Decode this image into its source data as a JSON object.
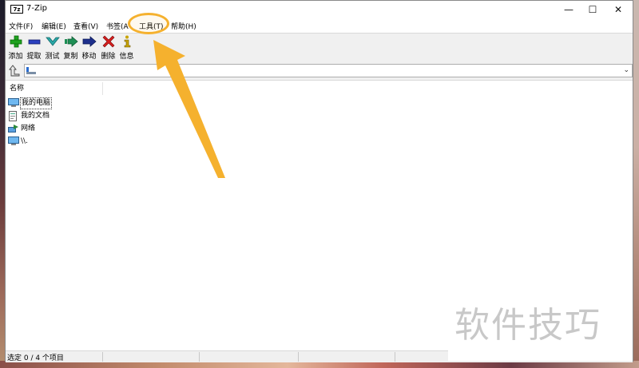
{
  "window": {
    "title": "7-Zip",
    "app_icon_text": "7z",
    "controls": [
      "minimize-icon",
      "maximize-icon",
      "close-icon"
    ]
  },
  "menu": [
    {
      "label": "文件(F)"
    },
    {
      "label": "编辑(E)"
    },
    {
      "label": "查看(V)"
    },
    {
      "label": "书签(A"
    },
    {
      "label": "工具(T)"
    },
    {
      "label": "帮助(H)"
    }
  ],
  "toolbar": {
    "buttons": [
      {
        "label": "添加",
        "icon": "plus-icon",
        "color": "#1fa21f"
      },
      {
        "label": "提取",
        "icon": "minus-icon",
        "color": "#2a3fbf"
      },
      {
        "label": "测试",
        "icon": "check-icon",
        "color": "#2aa8a8"
      },
      {
        "label": "复制",
        "icon": "copy-arrow-icon",
        "color": "#1e8f55"
      },
      {
        "label": "移动",
        "icon": "move-arrow-icon",
        "color": "#1d2f8c"
      },
      {
        "label": "删除",
        "icon": "delete-x-icon",
        "color": "#d41e1e"
      },
      {
        "label": "信息",
        "icon": "info-icon",
        "color": "#c9a400"
      }
    ]
  },
  "address": {
    "value": "",
    "icon": "computer-drive-icon"
  },
  "list": {
    "column_name": "名称",
    "items": [
      {
        "label": "我的电脑",
        "icon": "computer-icon",
        "focused": true
      },
      {
        "label": "我的文档",
        "icon": "documents-icon",
        "focused": false
      },
      {
        "label": "网络",
        "icon": "network-icon",
        "focused": false
      },
      {
        "label": "\\\\.",
        "icon": "computer-icon",
        "focused": false
      }
    ]
  },
  "status": {
    "text": "选定 0 / 4 个项目"
  },
  "watermark": {
    "text": "软件技巧"
  },
  "annotation": {
    "highlight_color": "#f5b12e",
    "target": "工具(T)"
  }
}
